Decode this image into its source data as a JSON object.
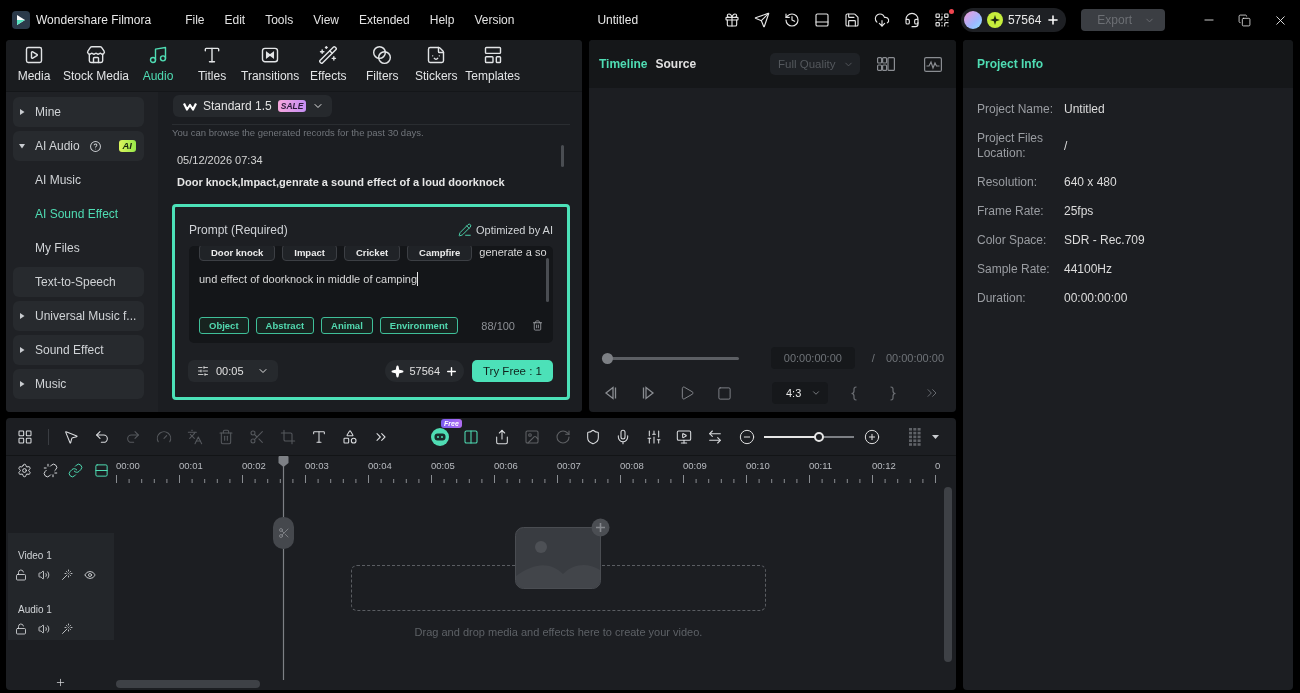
{
  "title_bar": {
    "app_name": "Wondershare Filmora",
    "menu": [
      "File",
      "Edit",
      "Tools",
      "View",
      "Extended",
      "Help",
      "Version"
    ],
    "project_title": "Untitled",
    "notification": true,
    "credits": "57564",
    "export": {
      "label": "Export",
      "disabled": true
    }
  },
  "media_tabs": [
    {
      "label": "Media",
      "selected": false
    },
    {
      "label": "Stock Media",
      "selected": false
    },
    {
      "label": "Audio",
      "selected": true
    },
    {
      "label": "Titles",
      "selected": false
    },
    {
      "label": "Transitions",
      "selected": false
    },
    {
      "label": "Effects",
      "selected": false
    },
    {
      "label": "Filters",
      "selected": false
    },
    {
      "label": "Stickers",
      "selected": false
    },
    {
      "label": "Templates",
      "selected": false
    }
  ],
  "sidebar": {
    "items": [
      {
        "kind": "group",
        "label": "Mine",
        "expanded": false,
        "selected": false,
        "help": false
      },
      {
        "kind": "group",
        "label": "AI Audio",
        "expanded": true,
        "selected": false,
        "help": true,
        "badge": "AI",
        "children": [
          {
            "label": "AI Music",
            "selected": false
          },
          {
            "label": "AI Sound Effect",
            "selected": true
          },
          {
            "label": "My Files",
            "selected": false
          }
        ]
      },
      {
        "kind": "link",
        "label": "Text-to-Speech",
        "selected": false,
        "help": false
      },
      {
        "kind": "group",
        "label": "Universal Music f...",
        "expanded": false,
        "selected": false,
        "help": false
      },
      {
        "kind": "group",
        "label": "Sound Effect",
        "expanded": false,
        "selected": false,
        "help": false
      },
      {
        "kind": "group",
        "label": "Music",
        "expanded": false,
        "selected": false,
        "help": false
      }
    ]
  },
  "ai_sound": {
    "model": {
      "label": "Standard 1.5",
      "badge": "SALE"
    },
    "notice": "You can browse the generated records for the past 30 days.",
    "records": [
      {
        "time": "05/12/2026 07:34",
        "prompt": "Door knock,Impact,genrate a sound effect of a loud doorknock"
      }
    ],
    "prompt": {
      "title": "Prompt (Required)",
      "optimized_label": "Optimized by AI",
      "tags": [
        "Door knock",
        "Impact",
        "Cricket",
        "Campfire"
      ],
      "value_lines": [
        "generate a so",
        "und effect of doorknock in middle of camping"
      ],
      "focused": true,
      "categories": [
        "Object",
        "Abstract",
        "Animal",
        "Environment"
      ],
      "count": "88/100",
      "duration": "00:05",
      "credits": "57564",
      "submit": "Try Free : 1"
    }
  },
  "preview": {
    "tabs": [
      {
        "label": "Timeline",
        "selected": true
      },
      {
        "label": "Source",
        "selected": false
      }
    ],
    "quality": {
      "label": "Full Quality",
      "disabled": true
    },
    "progress": {
      "level": 0
    },
    "current_time": "00:00:00:00",
    "separator": "/",
    "total_time": "00:00:00:00",
    "aspect_ratio": "4:3"
  },
  "project_info": {
    "title": "Project Info",
    "rows": [
      {
        "label": "Project Name:",
        "value": "Untitled"
      },
      {
        "label": "Project Files Location:",
        "value": "/"
      },
      {
        "label": "Resolution:",
        "value": "640 x 480"
      },
      {
        "label": "Frame Rate:",
        "value": "25fps"
      },
      {
        "label": "Color Space:",
        "value": "SDR - Rec.709"
      },
      {
        "label": "Sample Rate:",
        "value": "44100Hz"
      },
      {
        "label": "Duration:",
        "value": "00:00:00:00"
      }
    ]
  },
  "timeline": {
    "edit_tools": [
      {
        "disabled": false
      },
      {
        "disabled": false
      },
      {
        "disabled": true
      },
      {
        "disabled": true
      },
      {
        "disabled": true
      },
      {
        "disabled": true
      },
      {
        "disabled": true
      },
      {
        "disabled": true
      },
      {
        "disabled": false
      },
      {
        "disabled": false
      },
      {
        "disabled": false
      }
    ],
    "ai_tools": [
      {
        "on": true,
        "disabled": false,
        "badge": "Free"
      },
      {
        "on": true,
        "disabled": false
      },
      {
        "on": false,
        "disabled": false
      },
      {
        "on": false,
        "disabled": true
      },
      {
        "on": false,
        "disabled": true
      },
      {
        "on": false,
        "disabled": false
      },
      {
        "on": false,
        "disabled": false
      },
      {
        "on": false,
        "disabled": false
      },
      {
        "on": false,
        "disabled": false
      },
      {
        "on": false,
        "disabled": false
      }
    ],
    "zoom": {
      "level": 0.62
    },
    "ruler_tools": [
      {
        "on": false
      },
      {
        "on": false
      },
      {
        "on": true
      },
      {
        "on": true
      }
    ],
    "ruler": [
      "00:00",
      "00:01",
      "00:02",
      "00:03",
      "00:04",
      "00:05",
      "00:06",
      "00:07",
      "00:08",
      "00:09",
      "00:10",
      "00:11",
      "00:12",
      "0"
    ],
    "tracks": [
      {
        "kind": "video",
        "name": "Video 1"
      },
      {
        "kind": "audio",
        "name": "Audio 1"
      }
    ],
    "drop_hint": "Drag and drop media and effects here to create your video."
  }
}
